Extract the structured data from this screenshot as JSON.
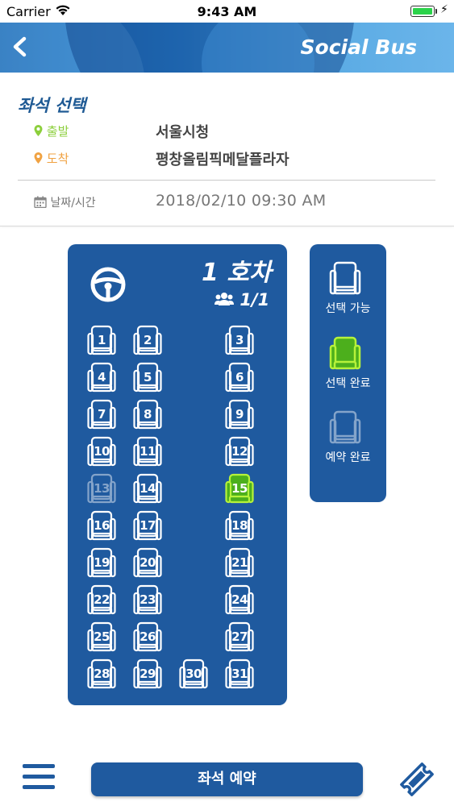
{
  "status_bar": {
    "carrier": "Carrier",
    "time": "9:43 AM"
  },
  "header": {
    "app_name": "Social Bus",
    "back_icon": "chevron-left-icon"
  },
  "info": {
    "section_title": "좌석 선택",
    "departure_label": "출발",
    "departure_value": "서울시청",
    "arrival_label": "도착",
    "arrival_value": "평창올림픽메달플라자",
    "datetime_label": "날짜/시간",
    "datetime_value": "2018/02/10 09:30 AM"
  },
  "bus": {
    "title": "1 호차",
    "passenger_count": "1/1",
    "seats": [
      {
        "num": "1",
        "state": "available"
      },
      {
        "num": "2",
        "state": "available"
      },
      {
        "num": "3",
        "state": "available"
      },
      {
        "num": "4",
        "state": "available"
      },
      {
        "num": "5",
        "state": "available"
      },
      {
        "num": "6",
        "state": "available"
      },
      {
        "num": "7",
        "state": "available"
      },
      {
        "num": "8",
        "state": "available"
      },
      {
        "num": "9",
        "state": "available"
      },
      {
        "num": "10",
        "state": "available"
      },
      {
        "num": "11",
        "state": "available"
      },
      {
        "num": "12",
        "state": "available"
      },
      {
        "num": "13",
        "state": "reserved"
      },
      {
        "num": "14",
        "state": "available"
      },
      {
        "num": "15",
        "state": "selected"
      },
      {
        "num": "16",
        "state": "available"
      },
      {
        "num": "17",
        "state": "available"
      },
      {
        "num": "18",
        "state": "available"
      },
      {
        "num": "19",
        "state": "available"
      },
      {
        "num": "20",
        "state": "available"
      },
      {
        "num": "21",
        "state": "available"
      },
      {
        "num": "22",
        "state": "available"
      },
      {
        "num": "23",
        "state": "available"
      },
      {
        "num": "24",
        "state": "available"
      },
      {
        "num": "25",
        "state": "available"
      },
      {
        "num": "26",
        "state": "available"
      },
      {
        "num": "27",
        "state": "available"
      },
      {
        "num": "28",
        "state": "available"
      },
      {
        "num": "29",
        "state": "available"
      },
      {
        "num": "30",
        "state": "available"
      },
      {
        "num": "31",
        "state": "available"
      }
    ]
  },
  "legend": {
    "available": "선택 가능",
    "selected": "선택 완료",
    "reserved": "예약 완료"
  },
  "bottom": {
    "reserve_button": "좌석 예약",
    "menu_icon": "hamburger-menu-icon",
    "ticket_icon": "ticket-icon"
  },
  "colors": {
    "primary": "#1f5a9f",
    "selected": "#7ed321",
    "departure": "#8ccf3c",
    "arrival": "#f0a242"
  }
}
